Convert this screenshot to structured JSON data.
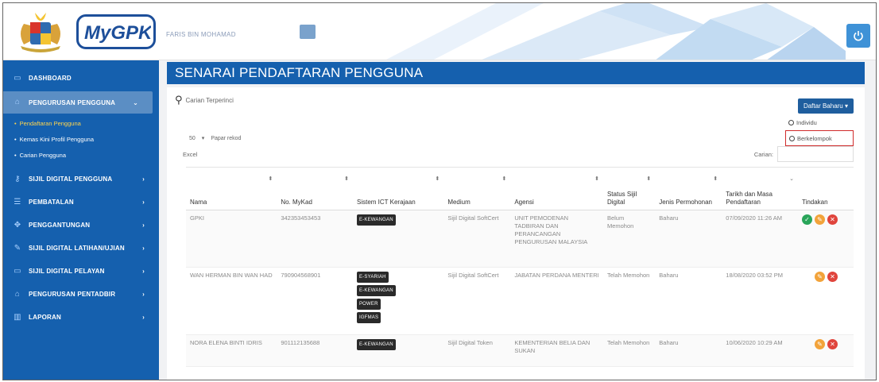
{
  "header": {
    "username": "FARIS BIN MOHAMAD"
  },
  "sidebar": {
    "items": [
      {
        "label": "DASHBOARD",
        "icon": "monitor-icon"
      },
      {
        "label": "PENGURUSAN PENGGUNA",
        "icon": "user-icon",
        "active": true
      },
      {
        "label": "SIJIL DIGITAL PENGGUNA",
        "icon": "key-icon"
      },
      {
        "label": "PEMBATALAN",
        "icon": "list-icon"
      },
      {
        "label": "PENGGANTUNGAN",
        "icon": "arrows-icon"
      },
      {
        "label": "SIJIL DIGITAL LATIHAN/UJIAN",
        "icon": "pen-icon"
      },
      {
        "label": "SIJIL DIGITAL PELAYAN",
        "icon": "server-icon"
      },
      {
        "label": "PENGURUSAN PENTADBIR",
        "icon": "admin-icon"
      },
      {
        "label": "LAPORAN",
        "icon": "chart-icon"
      }
    ],
    "subitems": [
      {
        "label": "Pendaftaran Pengguna",
        "current": true
      },
      {
        "label": "Kemas Kini Profil Pengguna"
      },
      {
        "label": "Carian Pengguna"
      }
    ]
  },
  "page": {
    "title": "SENARAI PENDAFTARAN PENGGUNA",
    "search_label": "Carian Terperinci",
    "daftar_button": "Daftar Baharu ▾",
    "dropdown": [
      "Individu",
      "Berkelompok"
    ],
    "page_size": "50",
    "records_label": "Papar rekod",
    "excel_label": "Excel",
    "cari_label": "Carian:"
  },
  "table": {
    "headers": [
      "Nama",
      "No. MyKad",
      "Sistem ICT Kerajaan",
      "Medium",
      "Agensi",
      "Status Sijil Digital",
      "Jenis Permohonan",
      "Tarikh dan Masa Pendaftaran",
      "Tindakan"
    ],
    "rows": [
      {
        "nama": "GPKI",
        "mykad": "342353453453",
        "sistem": [
          "E-KEWANGAN"
        ],
        "medium": "Sijil Digital SoftCert",
        "agensi": "UNIT PEMODENAN TADBIRAN DAN PERANCANGAN PENGURUSAN MALAYSIA",
        "status": "Belum Memohon",
        "jenis": "Baharu",
        "tarikh": "07/09/2020 11:26 AM",
        "actions": [
          "view",
          "edit",
          "delete"
        ]
      },
      {
        "nama": "WAN HERMAN BIN WAN HAD",
        "mykad": "790904568901",
        "sistem": [
          "E-SYARIAH",
          "E-KEWANGAN",
          "POWER",
          "IGFMAS"
        ],
        "medium": "Sijil Digital SoftCert",
        "agensi": "JABATAN PERDANA MENTERI",
        "status": "Telah Memohon",
        "jenis": "Baharu",
        "tarikh": "18/08/2020 03:52 PM",
        "actions": [
          "edit",
          "delete"
        ]
      },
      {
        "nama": "NORA ELENA BINTI IDRIS",
        "mykad": "901112135688",
        "sistem": [
          "E-KEWANGAN"
        ],
        "medium": "Sijil Digital Token",
        "agensi": "KEMENTERIAN BELIA DAN SUKAN",
        "status": "Telah Memohon",
        "jenis": "Baharu",
        "tarikh": "10/06/2020 10:29 AM",
        "actions": [
          "edit",
          "delete"
        ]
      }
    ]
  },
  "colors": {
    "primary": "#1560ae",
    "sidebar_active": "#5b8ec4",
    "highlight_border": "#d02b2b"
  }
}
